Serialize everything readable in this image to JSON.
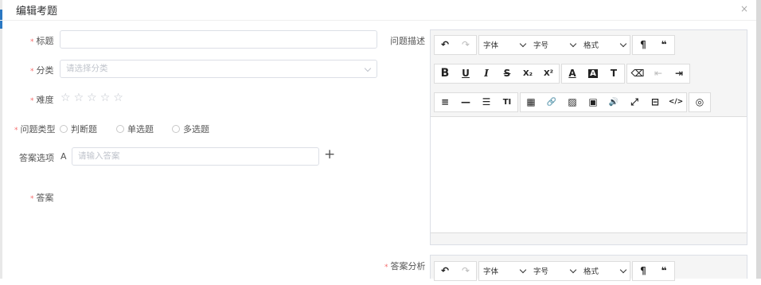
{
  "dialog": {
    "title": "编辑考题",
    "close_icon": "×"
  },
  "form": {
    "title_label": "标题",
    "category_label": "分类",
    "category_placeholder": "请选择分类",
    "difficulty_label": "难度",
    "difficulty_stars": [
      "☆",
      "☆",
      "☆",
      "☆",
      "☆"
    ],
    "difficulty_value": 0,
    "type_label": "问题类型",
    "type_options": [
      "判断题",
      "单选题",
      "多选题"
    ],
    "options_label": "答案选项",
    "option_letter": "A",
    "option_placeholder": "请输入答案",
    "add_icon": "+",
    "answer_label": "答案",
    "description_label": "问题描述",
    "analysis_label": "答案分析"
  },
  "editor": {
    "font_select": "字体",
    "size_select": "字号",
    "format_select": "格式",
    "buttons": {
      "undo": "↶",
      "redo": "↷",
      "paragraph": "¶",
      "quote": "❝",
      "bold": "B",
      "underline": "U",
      "italic": "I",
      "strike": "S",
      "subscript": "X₂",
      "superscript": "X²",
      "font_color": "A",
      "bg_color": "A",
      "clear_format": "T",
      "eraser": "⌫",
      "outdent": "⇤",
      "indent": "⇥",
      "align": "≡",
      "hr": "—",
      "list": "☰",
      "title": "TI",
      "table": "▦",
      "link": "🔗",
      "image": "▨",
      "video": "▣",
      "audio": "🔊",
      "fullscreen": "⤢",
      "html_block": "⊟",
      "code": "</>",
      "preview": "◎"
    }
  }
}
